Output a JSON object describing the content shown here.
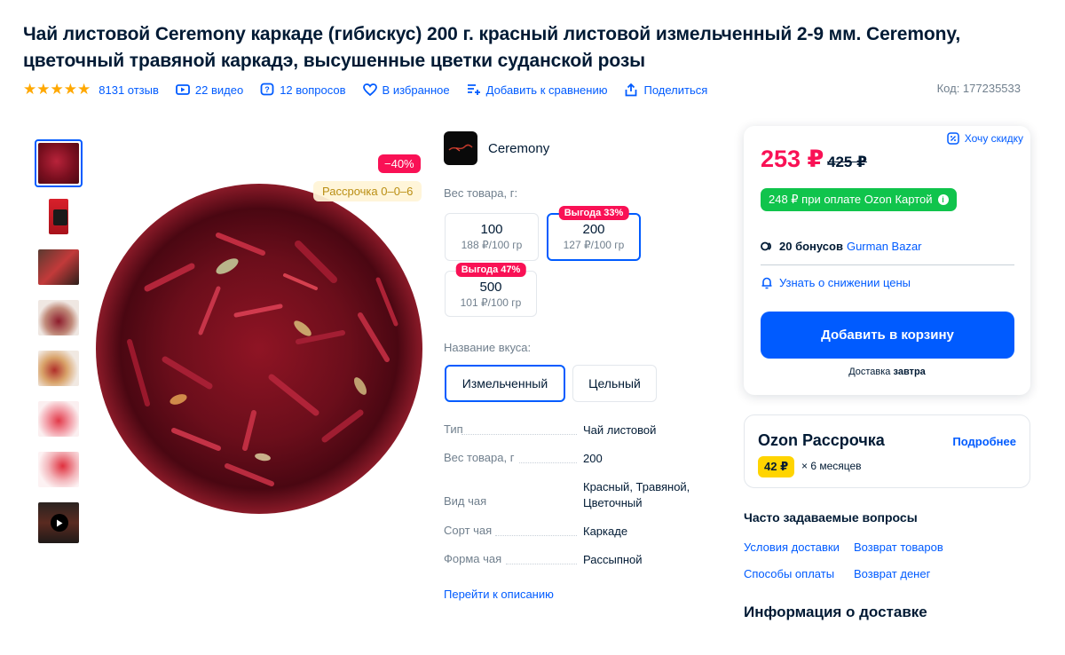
{
  "product": {
    "title": "Чай листовой Ceremony каркаде (гибискус) 200 г. красный листовой измельченный 2-9 мм. Ceremony, цветочный травяной каркадэ, высушенные цветки суданской розы",
    "rating": 5,
    "reviews": "8131 отзыв",
    "videos": "22 видео",
    "questions": "12 вопросов",
    "favorite": "В избранное",
    "compare": "Добавить к сравнению",
    "share": "Поделиться",
    "code": "Код: 177235533"
  },
  "gallery": {
    "discount_badge": "−40%",
    "installment_badge": "Рассрочка 0–0–6"
  },
  "brand": {
    "name": "Ceremony"
  },
  "weight": {
    "label": "Вес товара, г:",
    "options": [
      {
        "value": "100",
        "sub": "188 ₽/100 гр",
        "tag": ""
      },
      {
        "value": "200",
        "sub": "127 ₽/100 гр",
        "tag": "Выгода 33%"
      },
      {
        "value": "500",
        "sub": "101 ₽/100 гр",
        "tag": "Выгода 47%"
      }
    ]
  },
  "flavor": {
    "label": "Название вкуса:",
    "options": [
      "Измельченный",
      "Цельный"
    ]
  },
  "specs": [
    {
      "key": "Тип",
      "value": "Чай листовой"
    },
    {
      "key": "Вес товара, г",
      "value": "200"
    },
    {
      "key": "Вид чая",
      "value": "Красный, Травяной, Цветочный"
    },
    {
      "key": "Сорт чая",
      "value": "Каркаде"
    },
    {
      "key": "Форма чая",
      "value": "Рассыпной"
    }
  ],
  "to_description": "Перейти к описанию",
  "buy": {
    "price": "253 ₽",
    "old_price": "425 ₽",
    "want_discount": "Хочу скидку",
    "card_price": "248 ₽ при оплате Ozon Картой",
    "bonus_count": "20 бонусов",
    "bonus_shop": "Gurman Bazar",
    "notify": "Узнать о снижении цены",
    "cart": "Добавить в корзину",
    "delivery_prefix": "Доставка",
    "delivery_when": "завтра"
  },
  "installment": {
    "title": "Ozon Рассрочка",
    "more": "Подробнее",
    "amount": "42 ₽",
    "months": "× 6 месяцев"
  },
  "faq": {
    "title": "Часто задаваемые вопросы",
    "links": [
      "Условия доставки",
      "Возврат товаров",
      "Способы оплаты",
      "Возврат денег"
    ]
  },
  "delivery_info_title": "Информация о доставке",
  "colors": {
    "accent": "#005bff",
    "sale": "#f91155",
    "green": "#10c44c",
    "yellow": "#ffd400"
  }
}
